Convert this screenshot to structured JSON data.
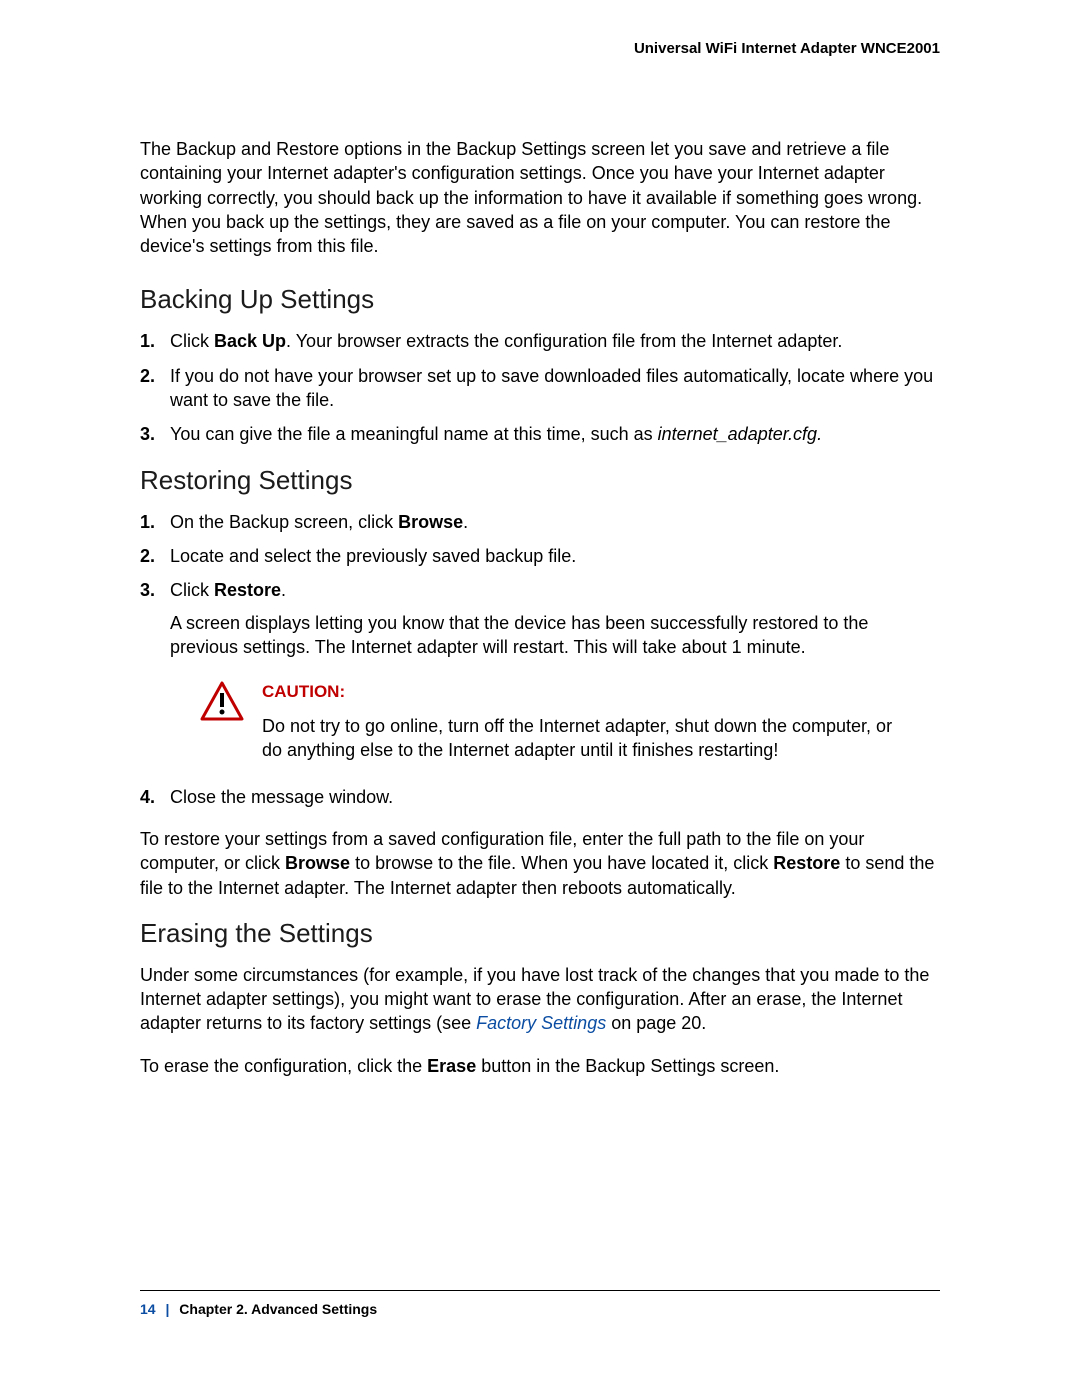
{
  "header": {
    "title": "Universal WiFi Internet Adapter WNCE2001"
  },
  "intro": "The Backup and Restore options in the Backup Settings screen let you save and retrieve a file containing your Internet adapter's configuration settings. Once you have your Internet adapter working correctly, you should back up the information to have it available if something goes wrong. When you back up the settings, they are saved as a file on your computer. You can restore the device's settings from this file.",
  "sections": {
    "backing_up": {
      "heading": "Backing Up Settings",
      "step1_pre": "Click ",
      "step1_bold": "Back Up",
      "step1_post": ". Your browser extracts the configuration file from the Internet adapter.",
      "step2": "If you do not have your browser set up to save downloaded files automatically, locate where you want to save the file.",
      "step3_pre": "You can give the file a meaningful name at this time, such as ",
      "step3_italic": "internet_adapter.cfg.",
      "step3_post": ""
    },
    "restoring": {
      "heading": "Restoring Settings",
      "step1_pre": "On the Backup screen, click ",
      "step1_bold": "Browse",
      "step1_post": ".",
      "step2": "Locate and select the previously saved backup file.",
      "step3_pre": "Click ",
      "step3_bold": "Restore",
      "step3_post": ".",
      "step3_after": "A screen displays letting you know that the device has been successfully restored to the previous settings. The Internet adapter will restart. This will take about 1 minute.",
      "caution_label": "CAUTION:",
      "caution_text": "Do not try to go online, turn off the Internet adapter, shut down the computer, or do anything else to the Internet adapter until it finishes restarting!",
      "step4": "Close the message window.",
      "para_pre": "To restore your settings from a saved configuration file, enter the full path to the file on your computer, or click ",
      "para_bold1": "Browse",
      "para_mid": " to browse to the file. When you have located it, click ",
      "para_bold2": "Restore",
      "para_post": " to send the file to the Internet adapter. The Internet adapter then reboots automatically."
    },
    "erasing": {
      "heading": "Erasing the Settings",
      "para1_pre": "Under some circumstances (for example, if you have lost track of the changes that you made to the Internet adapter settings), you might want to erase the configuration. After an erase, the Internet adapter returns to its factory settings (see ",
      "para1_link": "Factory Settings",
      "para1_post": " on page 20.",
      "para2_pre": "To erase the configuration, click the ",
      "para2_bold": "Erase",
      "para2_post": " button in the Backup Settings screen."
    }
  },
  "footer": {
    "page_number": "14",
    "separator": "|",
    "chapter": "Chapter 2.  Advanced Settings"
  }
}
